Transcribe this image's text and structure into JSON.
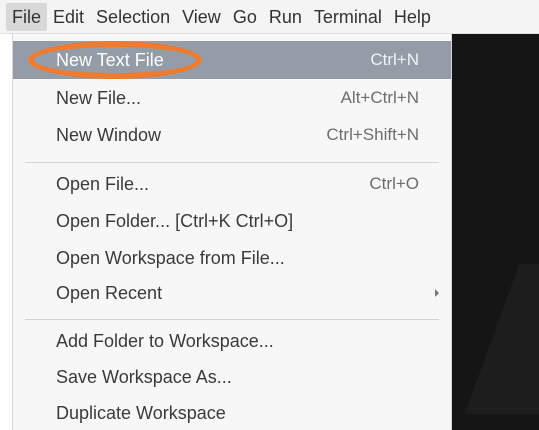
{
  "menubar": {
    "items": [
      "File",
      "Edit",
      "Selection",
      "View",
      "Go",
      "Run",
      "Terminal",
      "Help"
    ]
  },
  "file_menu": {
    "items": [
      {
        "label": "New Text File",
        "shortcut": "Ctrl+N"
      },
      {
        "label": "New File...",
        "shortcut": "Alt+Ctrl+N"
      },
      {
        "label": "New Window",
        "shortcut": "Ctrl+Shift+N"
      },
      {
        "label": "Open File...",
        "shortcut": "Ctrl+O"
      },
      {
        "label": "Open Folder... [Ctrl+K Ctrl+O]",
        "shortcut": ""
      },
      {
        "label": "Open Workspace from File...",
        "shortcut": ""
      },
      {
        "label": "Open Recent",
        "shortcut": ""
      },
      {
        "label": "Add Folder to Workspace...",
        "shortcut": ""
      },
      {
        "label": "Save Workspace As...",
        "shortcut": ""
      },
      {
        "label": "Duplicate Workspace",
        "shortcut": ""
      }
    ]
  },
  "colors": {
    "highlight": "#949ca7",
    "annotation": "#ef7b30",
    "editor_background": "#151515"
  }
}
